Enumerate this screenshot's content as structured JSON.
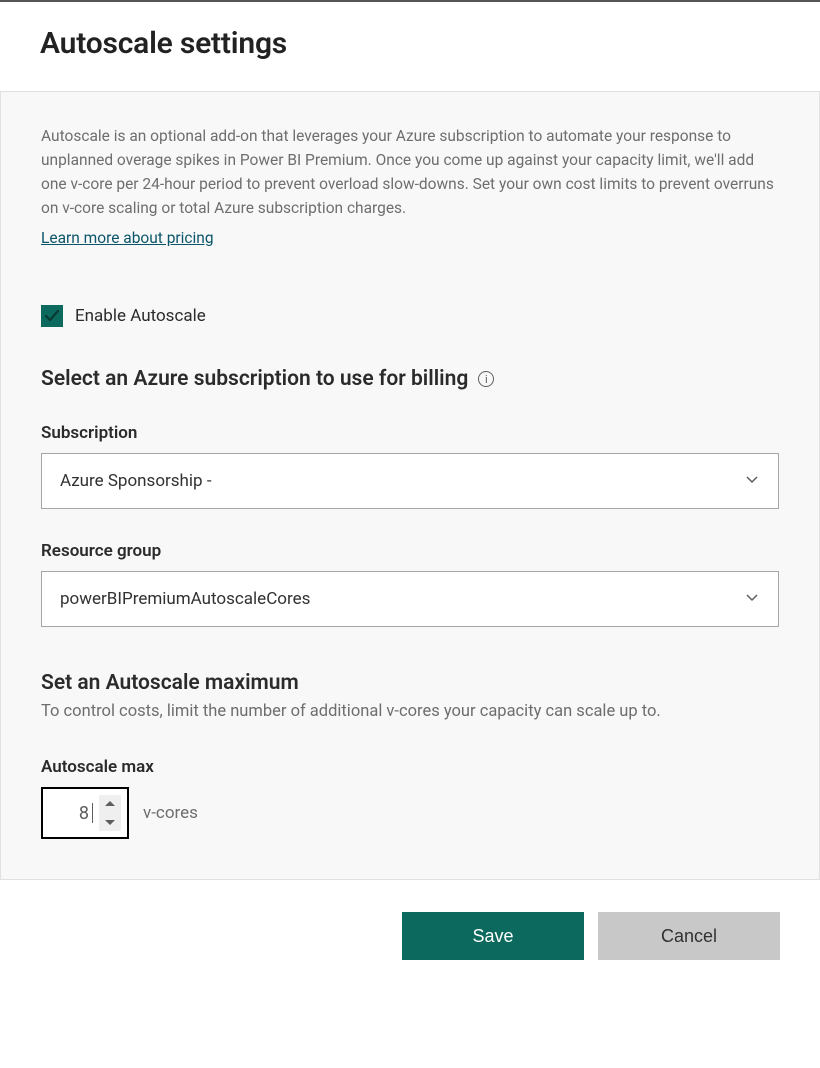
{
  "header": {
    "title": "Autoscale settings"
  },
  "description": "Autoscale is an optional add-on that leverages your Azure subscription to automate your response to unplanned overage spikes in Power BI Premium. Once you come up against your capacity limit, we'll add one v-core per 24-hour period to prevent overload slow-downs. Set your own cost limits to prevent overruns on v-core scaling or total Azure subscription charges.",
  "learnMore": "Learn more about pricing",
  "enable": {
    "label": "Enable Autoscale",
    "checked": true
  },
  "billing": {
    "heading": "Select an Azure subscription to use for billing",
    "subscription": {
      "label": "Subscription",
      "value": "Azure Sponsorship -"
    },
    "resourceGroup": {
      "label": "Resource group",
      "value": "powerBIPremiumAutoscaleCores"
    }
  },
  "maximum": {
    "heading": "Set an Autoscale maximum",
    "desc": "To control costs, limit the number of additional v-cores your capacity can scale up to.",
    "label": "Autoscale max",
    "value": "8",
    "unit": "v-cores"
  },
  "buttons": {
    "save": "Save",
    "cancel": "Cancel"
  }
}
